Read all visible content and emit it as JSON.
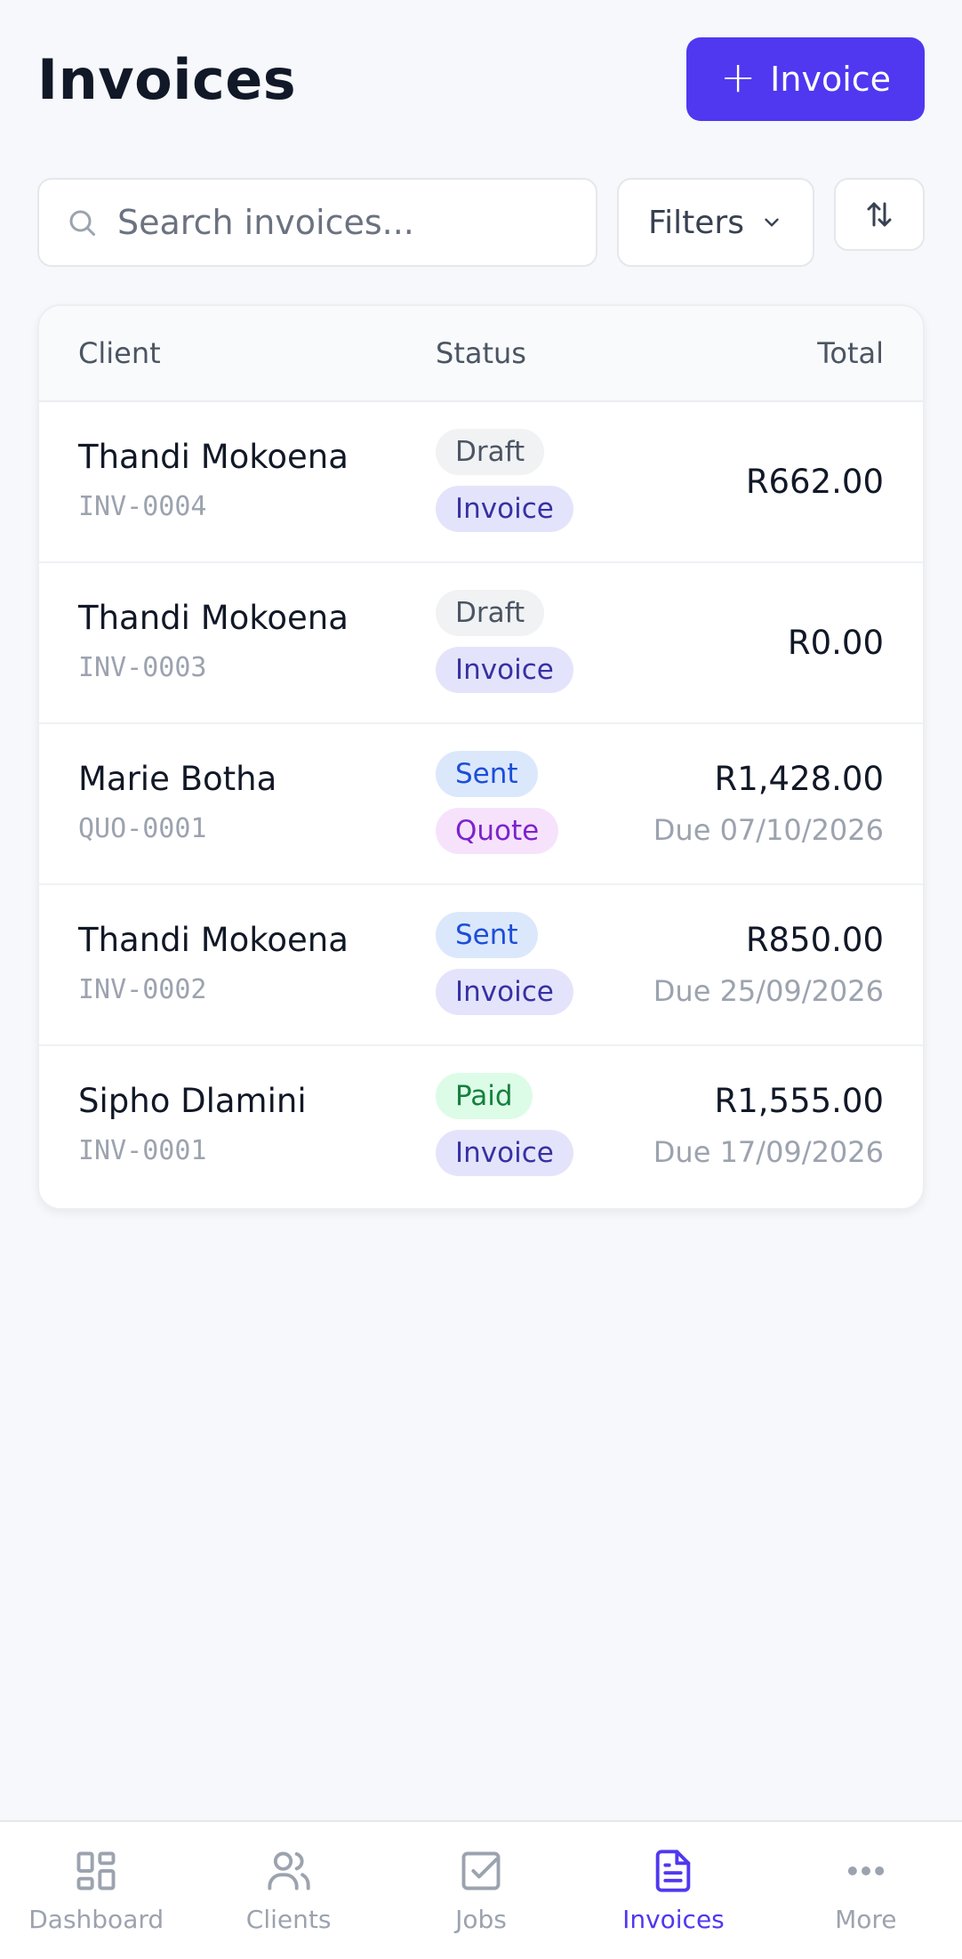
{
  "header": {
    "title": "Invoices",
    "new_button_label": "Invoice"
  },
  "toolbar": {
    "search_placeholder": "Search invoices...",
    "filters_label": "Filters"
  },
  "table": {
    "columns": {
      "client": "Client",
      "status": "Status",
      "total": "Total"
    },
    "rows": [
      {
        "client": "Thandi Mokoena",
        "number": "INV-0004",
        "status": "Draft",
        "type": "Invoice",
        "total": "R662.00",
        "due": ""
      },
      {
        "client": "Thandi Mokoena",
        "number": "INV-0003",
        "status": "Draft",
        "type": "Invoice",
        "total": "R0.00",
        "due": ""
      },
      {
        "client": "Marie Botha",
        "number": "QUO-0001",
        "status": "Sent",
        "type": "Quote",
        "total": "R1,428.00",
        "due": "Due 07/10/2026"
      },
      {
        "client": "Thandi Mokoena",
        "number": "INV-0002",
        "status": "Sent",
        "type": "Invoice",
        "total": "R850.00",
        "due": "Due 25/09/2026"
      },
      {
        "client": "Sipho Dlamini",
        "number": "INV-0001",
        "status": "Paid",
        "type": "Invoice",
        "total": "R1,555.00",
        "due": "Due 17/09/2026"
      }
    ]
  },
  "badge_colors": {
    "Draft": {
      "bg": "#f1f2f4",
      "fg": "#4b5563"
    },
    "Sent": {
      "bg": "#dbe8fc",
      "fg": "#1d4ed8"
    },
    "Paid": {
      "bg": "#dcfce7",
      "fg": "#15803d"
    },
    "Invoice": {
      "bg": "#e3e4fb",
      "fg": "#3730a3"
    },
    "Quote": {
      "bg": "#f6e3fb",
      "fg": "#7e22ce"
    }
  },
  "accent_color": "#4f38f0",
  "bottom_nav": [
    {
      "label": "Dashboard",
      "icon": "dashboard-icon",
      "active": false
    },
    {
      "label": "Clients",
      "icon": "users-icon",
      "active": false
    },
    {
      "label": "Jobs",
      "icon": "checkbox-icon",
      "active": false
    },
    {
      "label": "Invoices",
      "icon": "document-icon",
      "active": true
    },
    {
      "label": "More",
      "icon": "more-icon",
      "active": false
    }
  ]
}
